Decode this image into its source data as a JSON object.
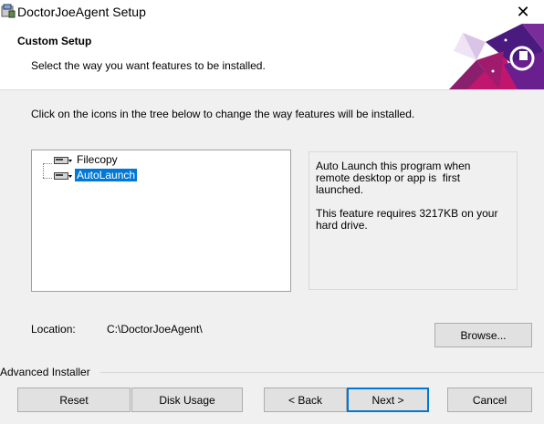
{
  "window": {
    "title": "DoctorJoeAgent Setup",
    "close_glyph": "✕"
  },
  "header": {
    "title": "Custom Setup",
    "subtitle": "Select the way you want features to be installed."
  },
  "instruction": "Click on the icons in the tree below to change the way features will be installed.",
  "tree": {
    "items": [
      {
        "label": "Filecopy",
        "icon": "drive-icon",
        "selected": false
      },
      {
        "label": "AutoLaunch",
        "icon": "drive-icon",
        "selected": true
      }
    ]
  },
  "description": {
    "line1": "Auto Launch this program when\nremote desktop or app is  first\nlaunched.",
    "line2": "This feature requires 3217KB on your\nhard drive."
  },
  "location": {
    "label": "Location:",
    "value": "C:\\DoctorJoeAgent\\"
  },
  "buttons": {
    "browse": "Browse...",
    "reset": "Reset",
    "disk_usage": "Disk Usage",
    "back": "< Back",
    "next": "Next >",
    "cancel": "Cancel"
  },
  "branding": "Advanced Installer",
  "colors": {
    "selection": "#0078d7",
    "logo_purple": "#5a1e8c",
    "logo_magenta": "#c0166e"
  }
}
